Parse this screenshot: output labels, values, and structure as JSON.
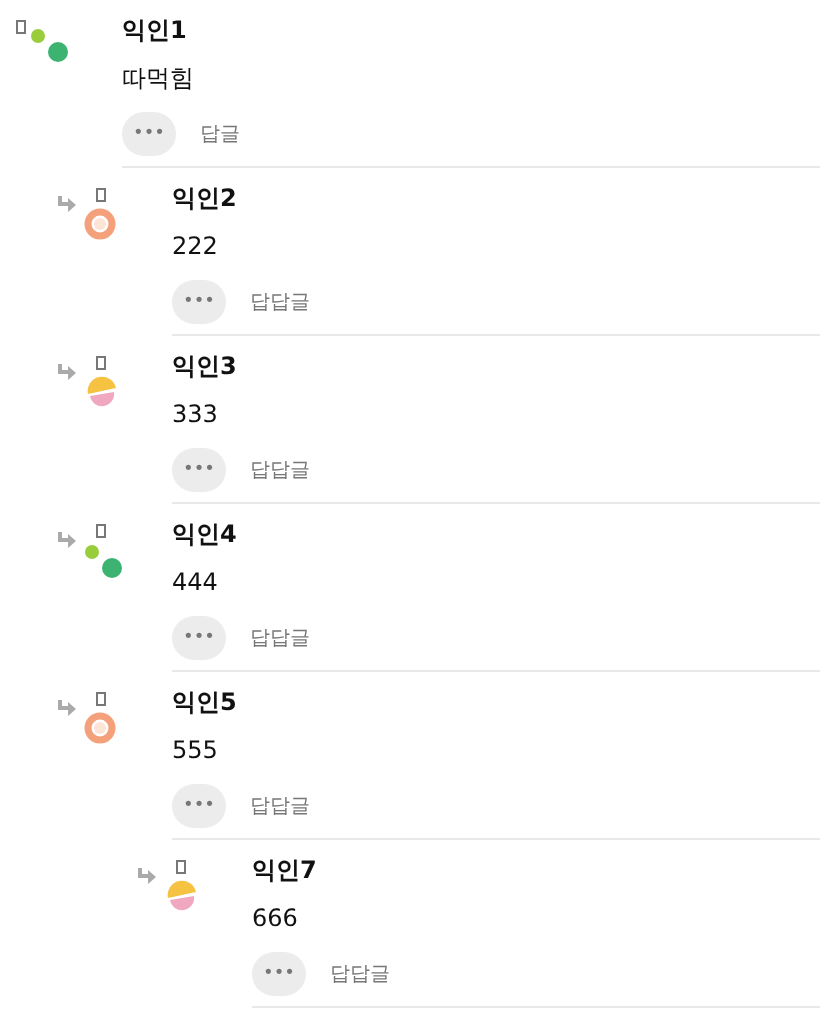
{
  "comments": [
    {
      "author": "익인1",
      "body": "따먹힘",
      "avatar": {
        "kind": "dots"
      },
      "menu": "•••",
      "action": "답글",
      "children": [
        {
          "author": "익인2",
          "body": "222",
          "avatar": {
            "kind": "ring"
          },
          "menu": "•••",
          "action": "답답글"
        },
        {
          "author": "익인3",
          "body": "333",
          "avatar": {
            "kind": "moon"
          },
          "menu": "•••",
          "action": "답답글"
        },
        {
          "author": "익인4",
          "body": "444",
          "avatar": {
            "kind": "dots"
          },
          "menu": "•••",
          "action": "답답글"
        },
        {
          "author": "익인5",
          "body": "555",
          "avatar": {
            "kind": "ring"
          },
          "menu": "•••",
          "action": "답답글",
          "children": [
            {
              "author": "익인7",
              "body": "666",
              "avatar": {
                "kind": "moon"
              },
              "menu": "•••",
              "action": "답답글"
            }
          ]
        }
      ]
    }
  ]
}
